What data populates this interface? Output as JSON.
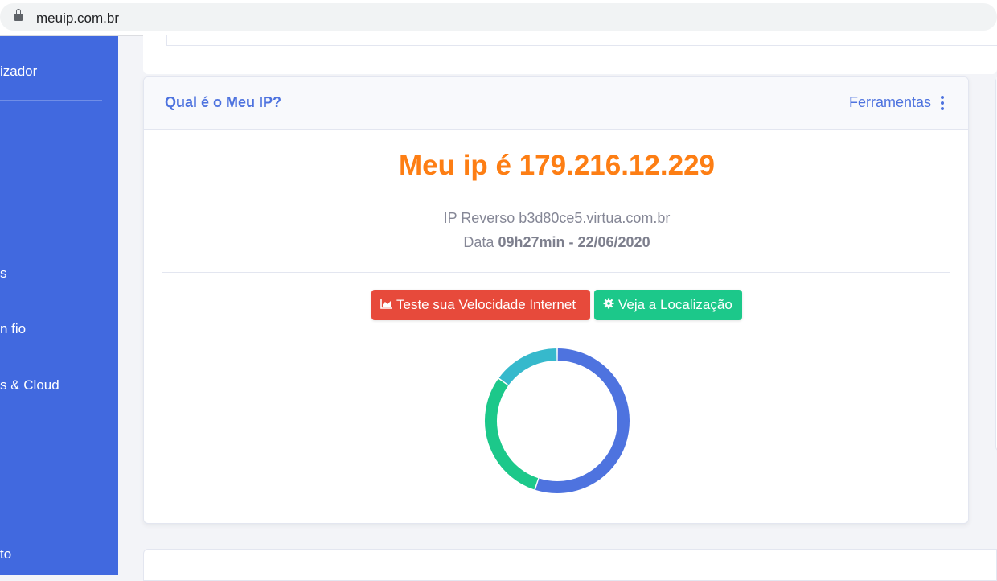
{
  "browser": {
    "url": "meuip.com.br"
  },
  "sidebar": {
    "items": [
      {
        "label": "izador"
      },
      {
        "label": "s"
      },
      {
        "label": "n fio"
      },
      {
        "label": "s & Cloud"
      },
      {
        "label": "to"
      }
    ]
  },
  "card": {
    "title": "Qual é o Meu IP?",
    "tools_label": "Ferramentas",
    "ip_title": "Meu ip é 179.216.12.229",
    "reverse_line": "IP Reverso b3d80ce5.virtua.com.br",
    "date_prefix": "Data",
    "date_value": "09h27min - 22/06/2020",
    "buttons": {
      "speed_test": "Teste sua Velocidade Internet",
      "location": "Veja a Localização"
    }
  },
  "donut": {
    "type": "pie",
    "values": [
      55,
      30,
      15
    ],
    "colors": [
      "#4e73df",
      "#1cc88a",
      "#36b9cc"
    ]
  },
  "colors": {
    "sidebar": "#4169df",
    "primary": "#4e73df",
    "orange": "#fd7e14",
    "danger": "#e74a3b",
    "success": "#1cc88a",
    "info": "#36b9cc"
  }
}
